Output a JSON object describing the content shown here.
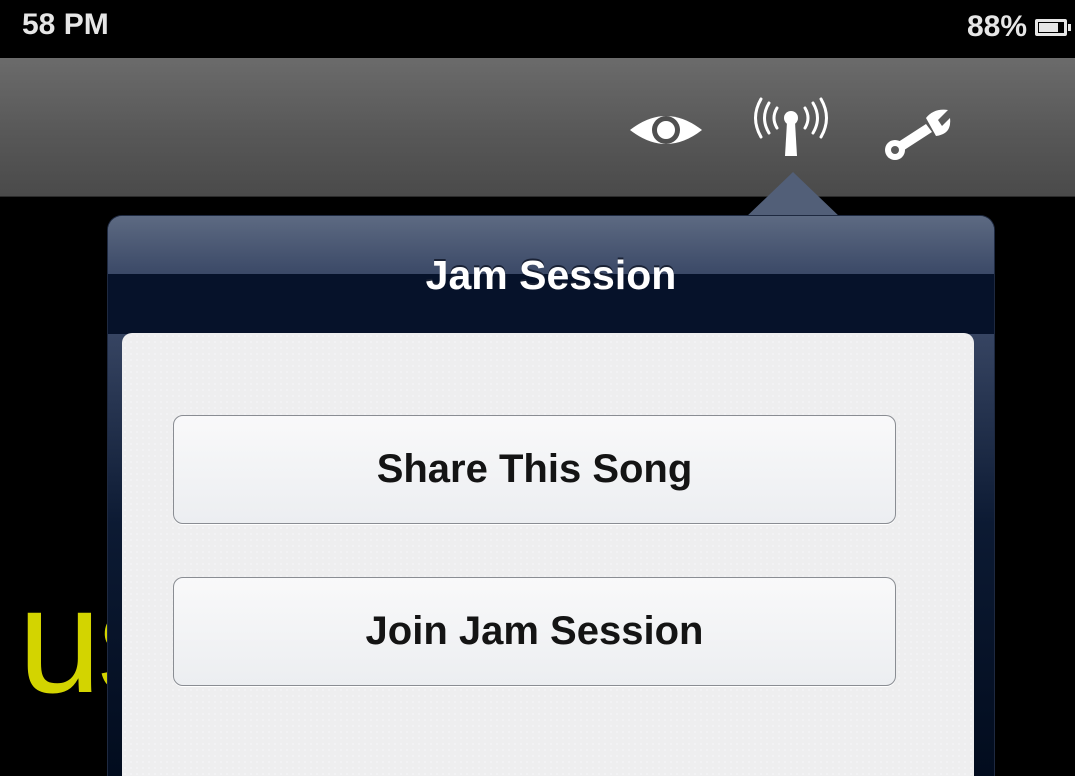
{
  "status_bar": {
    "time": "58 PM",
    "battery_percent": "88%",
    "battery_level": 0.88
  },
  "toolbar": {
    "icons": [
      "eye-icon",
      "wifi-broadcast-icon",
      "wrench-icon"
    ]
  },
  "background": {
    "lyric_fragment": "us",
    "lyric_color": "#d3d400"
  },
  "popover": {
    "title": "Jam Session",
    "buttons": [
      {
        "label": "Share This Song"
      },
      {
        "label": "Join Jam Session"
      }
    ]
  },
  "colors": {
    "toolbar": "#5a5a5a",
    "popover_header": "#3a4866",
    "popover_dark": "#06122a"
  }
}
